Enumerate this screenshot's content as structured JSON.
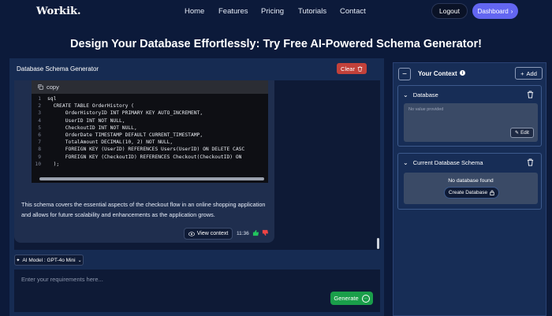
{
  "nav": {
    "logo": "Workik.",
    "links": [
      "Home",
      "Features",
      "Pricing",
      "Tutorials",
      "Contact"
    ],
    "logout_label": "Logout",
    "dashboard_label": "Dashboard"
  },
  "headline": "Design Your Database Effortlessly: Try Free AI-Powered Schema Generator!",
  "left_panel": {
    "title": "Database Schema Generator",
    "clear_label": "Clear",
    "code": {
      "copy_label": "copy",
      "lines": [
        {
          "num": "1",
          "text": "sql"
        },
        {
          "num": "2",
          "text": "  CREATE TABLE OrderHistory ("
        },
        {
          "num": "3",
          "text": "      OrderHistoryID INT PRIMARY KEY AUTO_INCREMENT,"
        },
        {
          "num": "4",
          "text": "      UserID INT NOT NULL,"
        },
        {
          "num": "5",
          "text": "      CheckoutID INT NOT NULL,"
        },
        {
          "num": "6",
          "text": "      OrderDate TIMESTAMP DEFAULT CURRENT_TIMESTAMP,"
        },
        {
          "num": "7",
          "text": "      TotalAmount DECIMAL(10, 2) NOT NULL,"
        },
        {
          "num": "8",
          "text": "      FOREIGN KEY (UserID) REFERENCES Users(UserID) ON DELETE CASC"
        },
        {
          "num": "9",
          "text": "      FOREIGN KEY (CheckoutID) REFERENCES Checkout(CheckoutID) ON"
        },
        {
          "num": "10",
          "text": "  );"
        }
      ]
    },
    "message": "This schema covers the essential aspects of the checkout flow in an online shopping application and allows for future scalability and enhancements as the application grows.",
    "view_context_label": "View context",
    "time": "11:36",
    "model_label": "AI Model : GPT-4o Mini",
    "input_placeholder": "Enter your requirements here...",
    "generate_label": "Generate"
  },
  "right_panel": {
    "title": "Your Context",
    "add_label": "Add",
    "database_card": {
      "title": "Database",
      "placeholder": "No value provided",
      "edit_label": "Edit"
    },
    "schema_card": {
      "title": "Current Database Schema",
      "empty_text": "No database found",
      "create_label": "Create Database"
    }
  },
  "colors": {
    "background": "#0c1a3a",
    "panel": "#162b52",
    "accent": "#6366f1",
    "clear": "#c2413a",
    "generate": "#1a9e4a"
  }
}
